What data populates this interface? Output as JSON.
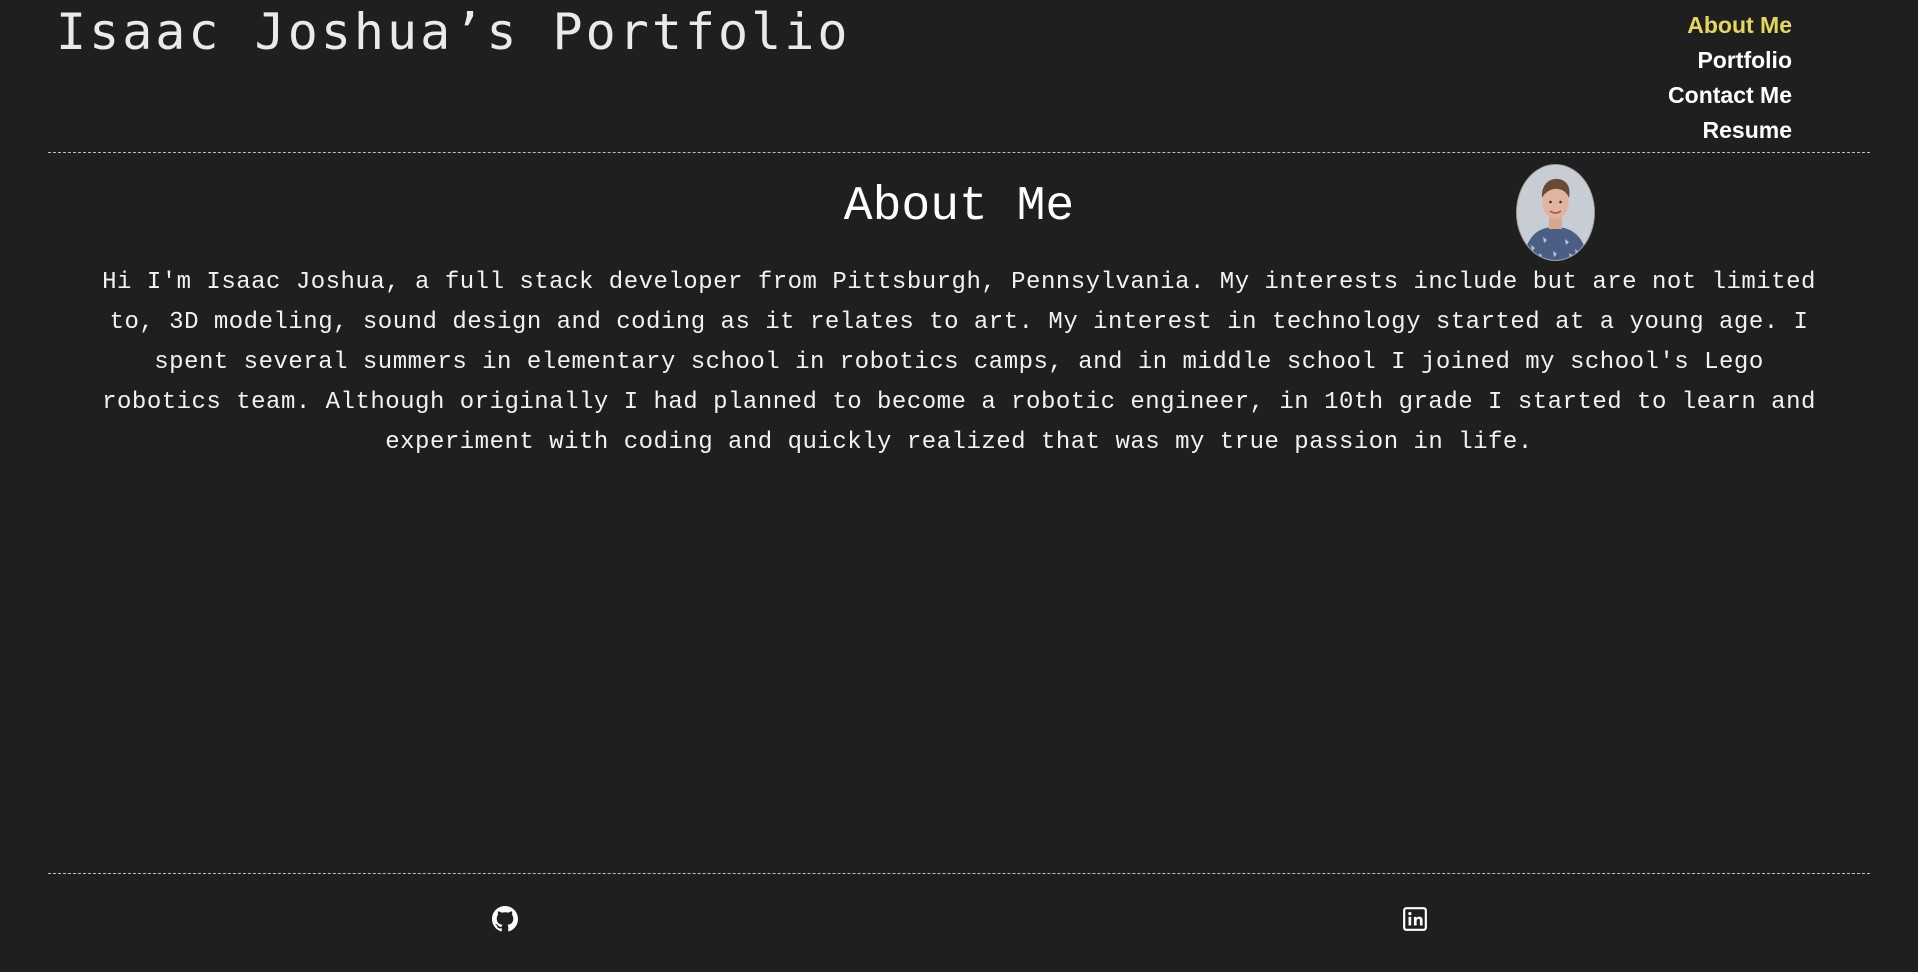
{
  "site": {
    "title": "Isaac Joshua’s Portfolio"
  },
  "nav": {
    "items": [
      {
        "label": "About Me",
        "active": true
      },
      {
        "label": "Portfolio",
        "active": false
      },
      {
        "label": "Contact Me",
        "active": false
      },
      {
        "label": "Resume",
        "active": false
      }
    ]
  },
  "about": {
    "heading": "About Me",
    "bio": "Hi I'm Isaac Joshua, a full stack developer from Pittsburgh, Pennsylvania. My interests include but are not limited to, 3D modeling, sound design and coding as it relates to art. My interest in technology started at a young age. I spent several summers in elementary school in robotics camps, and in middle school I joined my school's Lego robotics team. Although originally I had planned to become a robotic engineer, in 10th grade I started to learn and experiment with coding and quickly realized that was my true passion in life.",
    "avatar_alt": "profile-photo"
  },
  "footer": {
    "links": [
      {
        "icon": "github-icon"
      },
      {
        "icon": "linkedin-icon"
      }
    ]
  },
  "colors": {
    "background": "#1f1f1f",
    "text": "#ffffff",
    "accent": "#e6d65e",
    "divider": "#bdbdbd"
  }
}
